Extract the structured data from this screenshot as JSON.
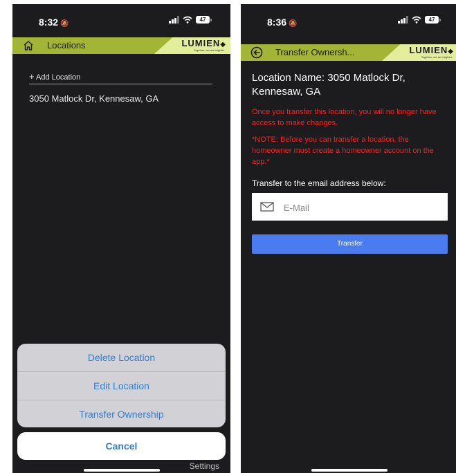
{
  "left_screen": {
    "status_bar": {
      "time": "8:32",
      "mute_icon": "bell-slash-icon",
      "battery": "47"
    },
    "header": {
      "title": "Locations",
      "home_icon": "home-icon"
    },
    "logo": {
      "text": "LUMIEN",
      "tagline": "Together, we are brighter."
    },
    "add_location": {
      "plus": "+",
      "label": "Add Location"
    },
    "locations": [
      "3050 Matlock Dr, Kennesaw, GA"
    ],
    "action_sheet": {
      "items": [
        {
          "label": "Delete Location"
        },
        {
          "label": "Edit Location"
        },
        {
          "label": "Transfer Ownership"
        }
      ],
      "cancel": "Cancel"
    },
    "tab_bar": {
      "settings": "Settings"
    }
  },
  "right_screen": {
    "status_bar": {
      "time": "8:36",
      "mute_icon": "bell-slash-icon",
      "battery": "47"
    },
    "header": {
      "title": "Transfer Ownersh...",
      "back_icon": "back-arrow-icon"
    },
    "logo": {
      "text": "LUMIEN",
      "tagline": "Together, we are brighter."
    },
    "location_name": "Location Name: 3050 Matlock Dr, Kennesaw, GA",
    "warning": "Once you transfer this location, you will no longer have access to make changes.",
    "note": "*NOTE: Before you can transfer a location, the homeowner must create a homeowner account on the app.*",
    "transfer_label": "Transfer to the email address below:",
    "email": {
      "placeholder": "E-Mail",
      "value": ""
    },
    "transfer_button": "Transfer"
  },
  "colors": {
    "header_green": "#a2b534",
    "logo_band": "#e2ee9a",
    "background": "#1c1c1e",
    "action_blue": "#2f7ed6",
    "button_blue": "#4a7cf0",
    "warning_red": "#ff2020"
  }
}
